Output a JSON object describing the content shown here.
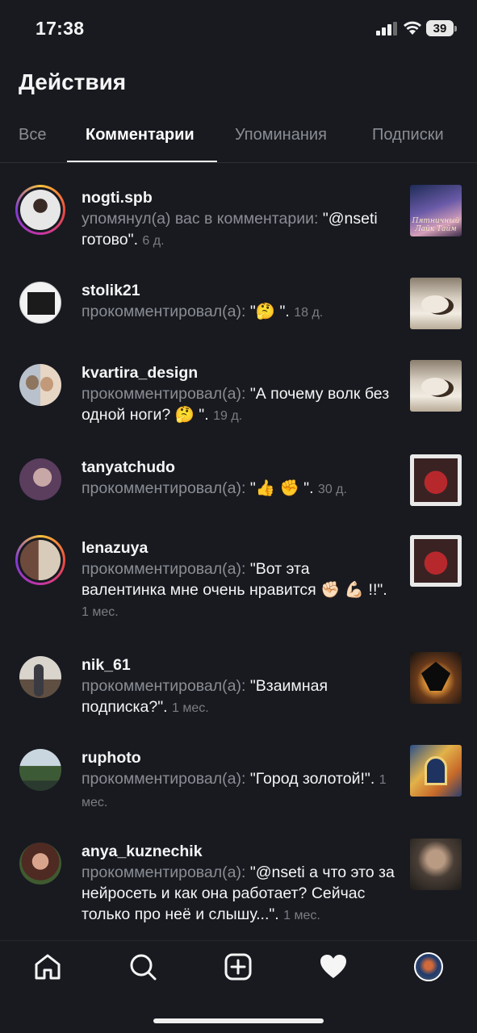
{
  "status_bar": {
    "time": "17:38",
    "battery": "39"
  },
  "header": {
    "title": "Действия"
  },
  "tabs": [
    {
      "label": "Все",
      "active": false
    },
    {
      "label": "Комментарии",
      "active": true
    },
    {
      "label": "Упоминания",
      "active": false
    },
    {
      "label": "Подписки",
      "active": false
    }
  ],
  "notifications": [
    {
      "username": "nogti.spb",
      "action": "упомянул(а) вас в комментарии:",
      "text": "\"@nseti готово\"",
      "time": "6 д.",
      "thumb_caption": "Пятничный Лайк Тайм"
    },
    {
      "username": "stolik21",
      "action": "прокомментировал(а):",
      "text": "\"🤔 \"",
      "time": "18 д."
    },
    {
      "username": "kvartira_design",
      "action": "прокомментировал(а):",
      "text": "\"А почему волк без одной ноги? 🤔 \"",
      "time": "19 д."
    },
    {
      "username": "tanyatchudo",
      "action": "прокомментировал(а):",
      "text": "\"👍 ✊ \"",
      "time": "30 д."
    },
    {
      "username": "lenazuya",
      "action": "прокомментировал(а):",
      "text": "\"Вот эта валентинка мне очень нравится ✊🏻 💪🏻 !!\"",
      "time": "1 мес."
    },
    {
      "username": "nik_61",
      "action": "прокомментировал(а):",
      "text": "\"Взаимная подписка?\"",
      "time": "1 мес."
    },
    {
      "username": "ruphoto",
      "action": "прокомментировал(а):",
      "text": "\"Город золотой!\"",
      "time": "1 мес."
    },
    {
      "username": "anya_kuznechik",
      "action": "прокомментировал(а):",
      "text": "\"@nseti а что это за нейросеть и как она работает? Сейчас только про неё и слышу...\"",
      "time": "1 мес."
    }
  ],
  "bottom_nav": [
    {
      "icon": "home-icon"
    },
    {
      "icon": "search-icon"
    },
    {
      "icon": "add-post-icon"
    },
    {
      "icon": "heart-icon",
      "active": true
    },
    {
      "icon": "profile-avatar"
    }
  ],
  "colors": {
    "background": "#181a20",
    "secondary_text": "#8a8d94",
    "active_tab": "#ffffff"
  }
}
